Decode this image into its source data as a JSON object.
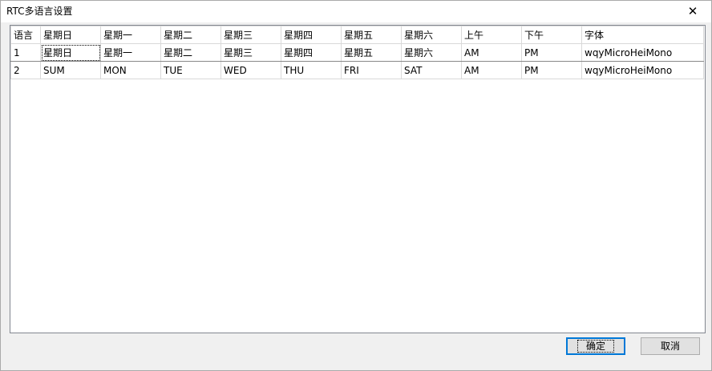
{
  "window": {
    "title": "RTC多语言设置",
    "close_glyph": "✕"
  },
  "grid": {
    "columns": [
      "语言",
      "星期日",
      "星期一",
      "星期二",
      "星期三",
      "星期四",
      "星期五",
      "星期六",
      "上午",
      "下午",
      "字体"
    ],
    "rows": [
      [
        "1",
        "星期日",
        "星期一",
        "星期二",
        "星期三",
        "星期四",
        "星期五",
        "星期六",
        "AM",
        "PM",
        "wqyMicroHeiMono"
      ],
      [
        "2",
        "SUM",
        "MON",
        "TUE",
        "WED",
        "THU",
        "FRI",
        "SAT",
        "AM",
        "PM",
        "wqyMicroHeiMono"
      ]
    ]
  },
  "buttons": {
    "ok_label": "确定",
    "cancel_label": "取消"
  }
}
